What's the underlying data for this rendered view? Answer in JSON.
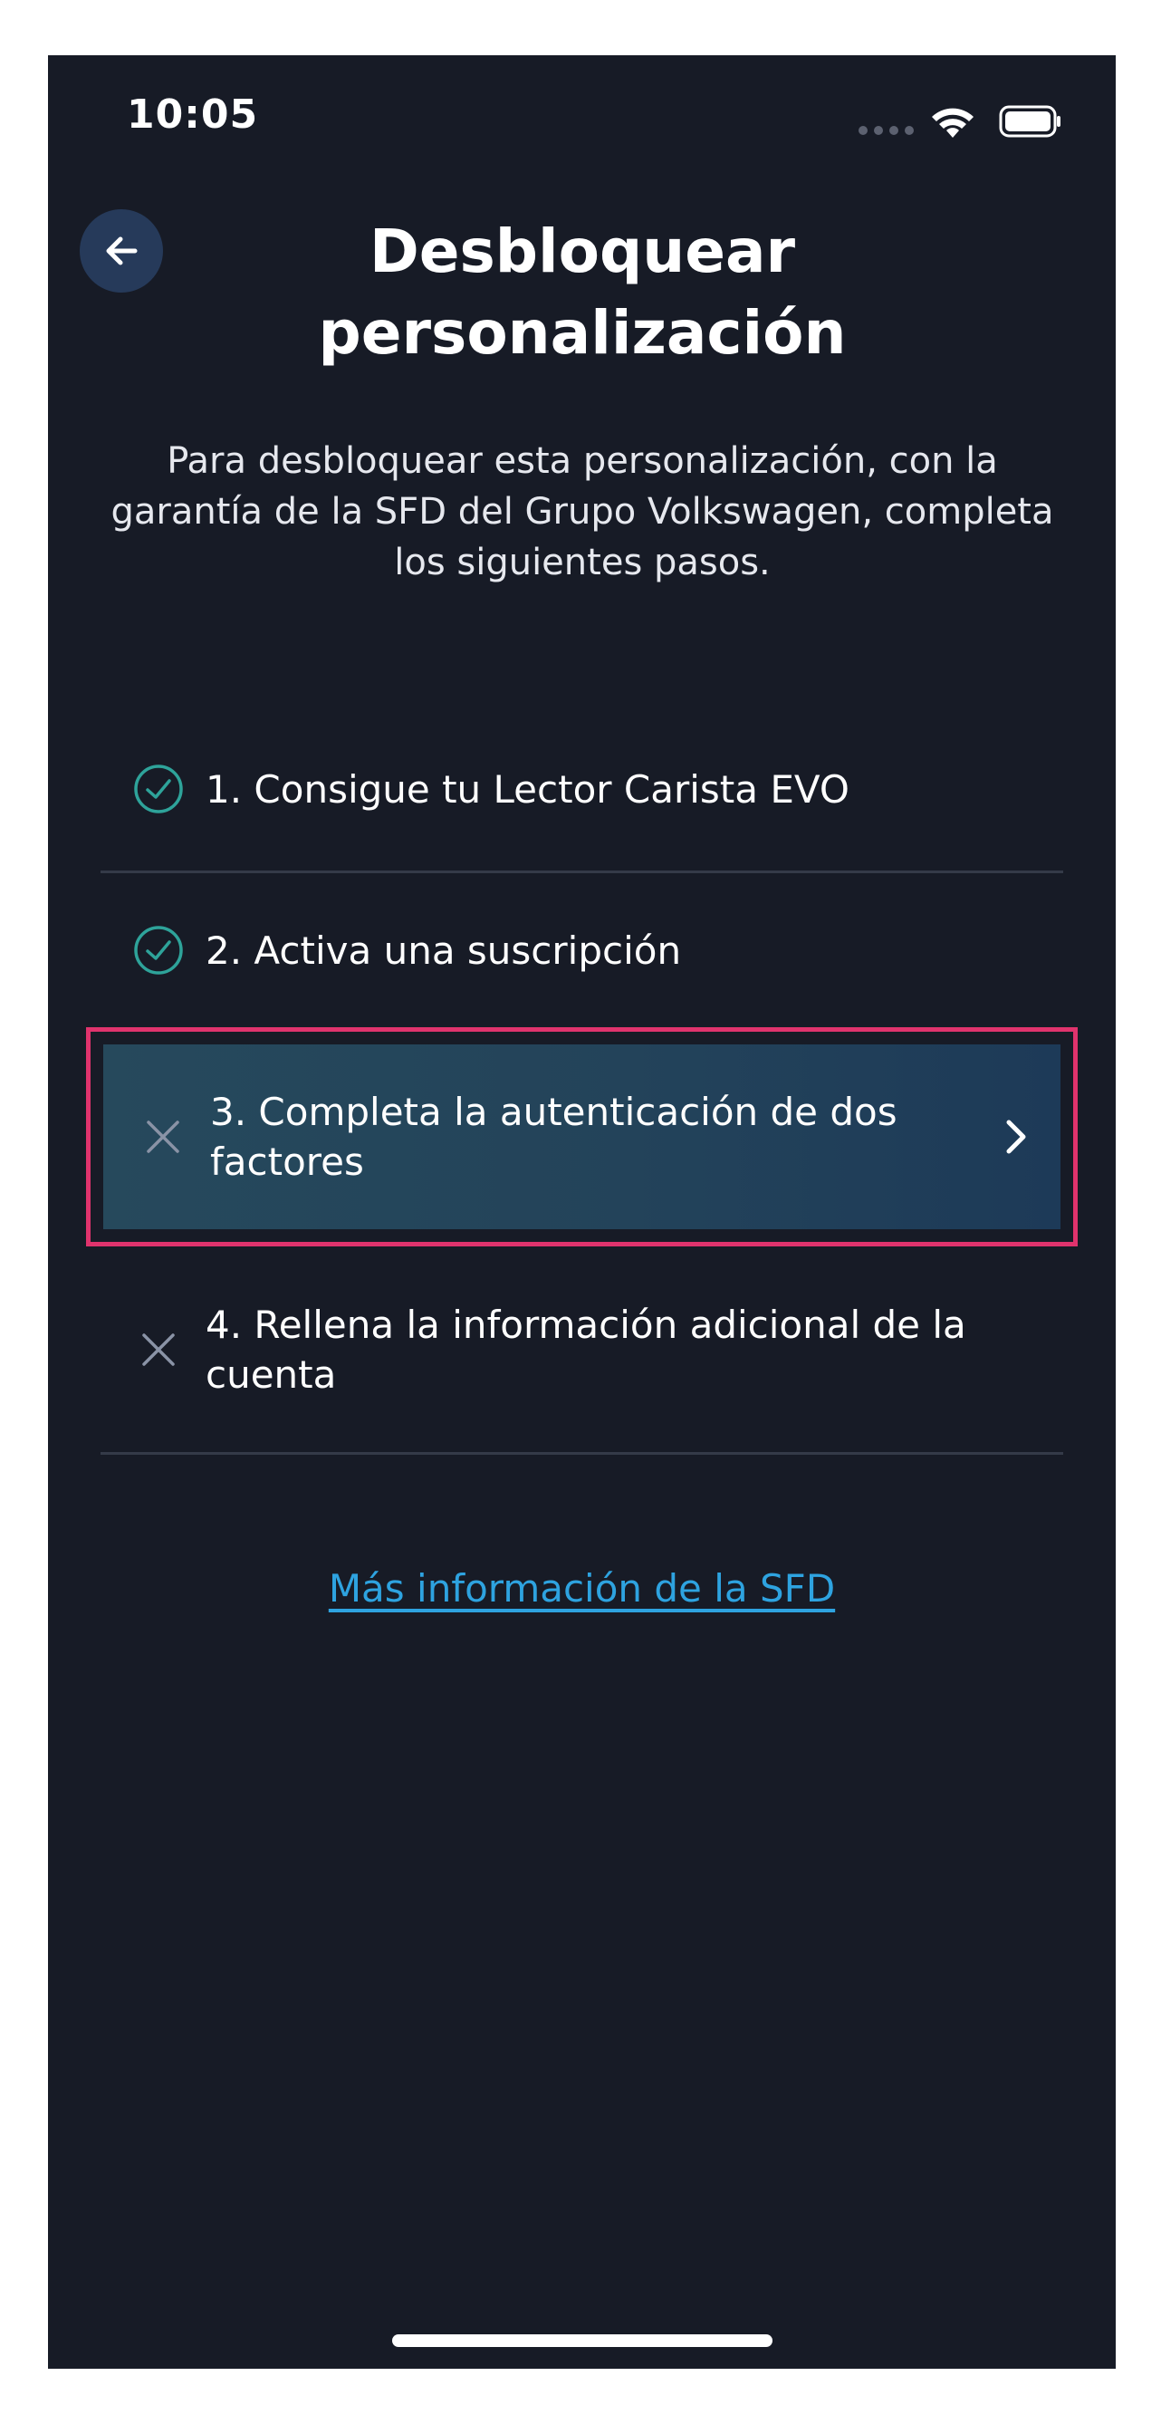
{
  "status_bar": {
    "time": "10:05"
  },
  "header": {
    "back_icon": "arrow-left-icon",
    "title": "Desbloquear personalización"
  },
  "intro": {
    "text": "Para desbloquear esta personalización, con la garantía de la SFD del Grupo Volkswagen, completa los siguientes pasos."
  },
  "steps": [
    {
      "label": "1. Consigue tu Lector Carista EVO",
      "status": "completed",
      "icon": "check-circle-icon"
    },
    {
      "label": "2. Activa una suscripción",
      "status": "completed",
      "icon": "check-circle-icon"
    },
    {
      "label": "3. Completa la autenticación de dos factores",
      "status": "pending",
      "icon": "x-icon",
      "highlighted": true
    },
    {
      "label": "4. Rellena la información adicional de la cuenta",
      "status": "pending",
      "icon": "x-icon"
    }
  ],
  "more_info_link": "Más información de la SFD",
  "colors": {
    "background": "#171b26",
    "accent_link": "#2ea3e0",
    "check": "#2ea39a",
    "highlight_border": "#e0336d"
  }
}
